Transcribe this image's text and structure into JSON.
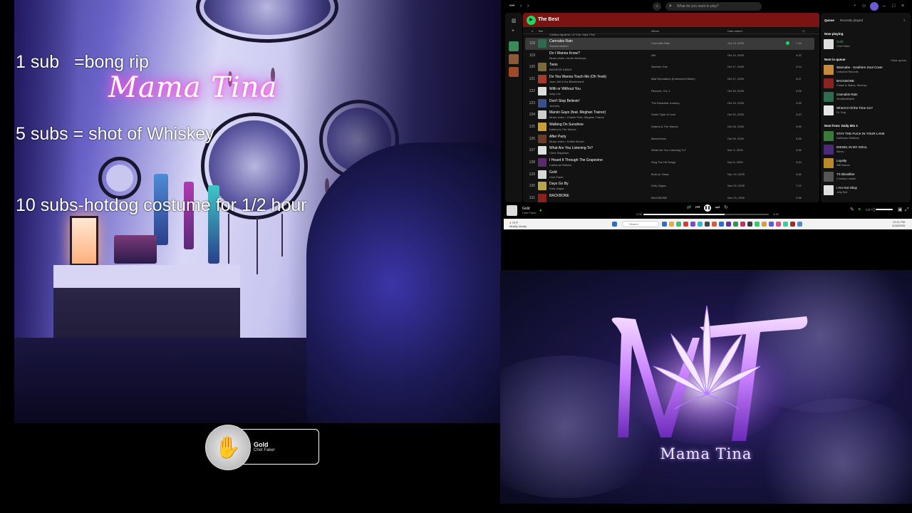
{
  "overlay": {
    "goals": [
      "1 sub   =bong rip",
      "5 subs = shot of Whiskey",
      "10 subs-hotdog costume for 1/2 hour"
    ],
    "now_playing_widget": {
      "title": "Gold",
      "artist": "Chet Faker"
    }
  },
  "webcam": {
    "neon_sign": "Mama Tina"
  },
  "spotify": {
    "search_placeholder": "What do you want to play?",
    "playlist_title": "The Best",
    "columns": {
      "num": "#",
      "title": "Title",
      "album": "Album",
      "date": "Date added"
    },
    "partial_row_artist": "Cristina Aguilera, Lil' Kim, Mya, Pink",
    "tracks": [
      {
        "num": "118",
        "title": "Cannabis Rain",
        "artist": "Stoolbenthatch",
        "album": "Cannabis Rain",
        "date": "Oct 13, 2025",
        "dur": "7:15",
        "selected": true,
        "color": "#2e6b4f"
      },
      {
        "num": "119",
        "title": "Do I Wanna Know?",
        "artist": "Music video • Arctic Monkeys",
        "album": "AM",
        "date": "Oct 14, 2025",
        "dur": "4:32",
        "selected": false,
        "color": "#111111"
      },
      {
        "num": "120",
        "title": "Twos",
        "artist": "MASSIVE KABLE",
        "album": "Number One",
        "date": "Oct 17, 2025",
        "dur": "4:14",
        "selected": false,
        "color": "#7a6a3c"
      },
      {
        "num": "121",
        "title": "Do You Wanna Touch Me (Oh Yeah)",
        "artist": "Joan Jett & the Blackhearts",
        "album": "Bad Reputation (Extended Edition)",
        "date": "Oct 17, 2025",
        "dur": "3:47",
        "selected": false,
        "color": "#a33a2a"
      },
      {
        "num": "122",
        "title": "With or Without You",
        "artist": "Amy Lee",
        "album": "Recover, Vol. 1",
        "date": "Oct 18, 2025",
        "dur": "4:08",
        "selected": false,
        "color": "#dddddd"
      },
      {
        "num": "123",
        "title": "Don't Stop Believin'",
        "artist": "Journey",
        "album": "The Essential Journey",
        "date": "Oct 19, 2025",
        "dur": "4:09",
        "selected": false,
        "color": "#3b4f8a"
      },
      {
        "num": "124",
        "title": "Marvin Gaye (feat. Meghan Trainor)",
        "artist": "Music video • Charlie Puth, Meghan Trainor",
        "album": "Some Type of Love",
        "date": "Oct 22, 2025",
        "dur": "3:10",
        "selected": false,
        "color": "#cccccc"
      },
      {
        "num": "125",
        "title": "Walking On Sunshine",
        "artist": "Katrina & The Waves",
        "album": "Katrina & The Waves",
        "date": "Oct 26, 2025",
        "dur": "3:59",
        "selected": false,
        "color": "#c9a13b"
      },
      {
        "num": "126",
        "title": "After Party",
        "artist": "Music video • Koffee Brown",
        "album": "Mars/Venus",
        "date": "Oct 29, 2025",
        "dur": "3:55",
        "selected": false,
        "color": "#6a3a2a"
      },
      {
        "num": "127",
        "title": "What Are You Listening To?",
        "artist": "Chris Stapleton",
        "album": "What Are You Listening To?",
        "date": "Nov 3, 2025",
        "dur": "4:06",
        "selected": false,
        "color": "#e0e0e0"
      },
      {
        "num": "128",
        "title": "I Heard It Through The Grapevine",
        "artist": "California Raisins",
        "album": "Sing The Hit Songs",
        "date": "Nov 6, 2025",
        "dur": "3:44",
        "selected": false,
        "color": "#5a2a6a"
      },
      {
        "num": "129",
        "title": "Gold",
        "artist": "Chet Faker",
        "album": "Built on Glass",
        "date": "Nov 19, 2025",
        "dur": "4:45",
        "selected": false,
        "color": "#d8d8d8"
      },
      {
        "num": "130",
        "title": "Days Go By",
        "artist": "Dirty Vegas",
        "album": "Dirty Vegas",
        "date": "Nov 20, 2025",
        "dur": "7:12",
        "selected": false,
        "color": "#b8a44a"
      },
      {
        "num": "131",
        "title": "BACKBONE",
        "artist": "",
        "album": "BACKBONE",
        "date": "Nov 23, 2025",
        "dur": "2:58",
        "selected": false,
        "color": "#8a2222"
      }
    ],
    "queue": {
      "tab_queue": "Queue",
      "tab_recent": "Recently played",
      "now_playing_label": "Now playing",
      "now_playing": {
        "title": "Gold",
        "artist": "Chet Faker",
        "color": "#dddddd"
      },
      "next_in_queue_label": "Next in queue",
      "clear_label": "Clear queue",
      "next_items": [
        {
          "title": "Wannabe - Southern Soul Cover",
          "artist": "Unbound Records",
          "color": "#c98a3a"
        },
        {
          "title": "BACKBONE",
          "artist": "Chase & Status, Stormzy",
          "color": "#8a2222"
        },
        {
          "title": "Cannabis Rain",
          "artist": "Stoolbenthatch",
          "color": "#2e6b4f"
        },
        {
          "title": "Where'd All the Time Go?",
          "artist": "Dr. Dog",
          "color": "#e6e6e6"
        }
      ],
      "next_from_label": "Next from: Daily Mix 1",
      "from_items": [
        {
          "title": "STAY THE FUCK IN YOUR LANE",
          "artist": "DaShawn Williams",
          "color": "#3a7a3a"
        },
        {
          "title": "DIESEL IN MY SOUL",
          "artist": "Klineo",
          "color": "#4a2a7a"
        },
        {
          "title": "Loyalty",
          "artist": "Wilt Maxon",
          "color": "#b88a2a"
        },
        {
          "title": "TX Bloodline",
          "artist": "Country Lunatic",
          "color": "#555555"
        },
        {
          "title": "I Am Not Okay",
          "artist": "Jelly Roll",
          "color": "#e0e0e0"
        }
      ]
    },
    "player": {
      "title": "Gold",
      "artist": "Chet Faker",
      "elapsed": "3:05",
      "total": "4:45",
      "progress": 0.65
    }
  },
  "taskbar": {
    "weather": "70°F",
    "weather_sub": "Mostly cloudy",
    "search": "Search",
    "time": "12:21 PM",
    "date": "4/18/2026"
  },
  "logo": {
    "brand_name": "Mama Tina",
    "accent": "#c77dff"
  }
}
